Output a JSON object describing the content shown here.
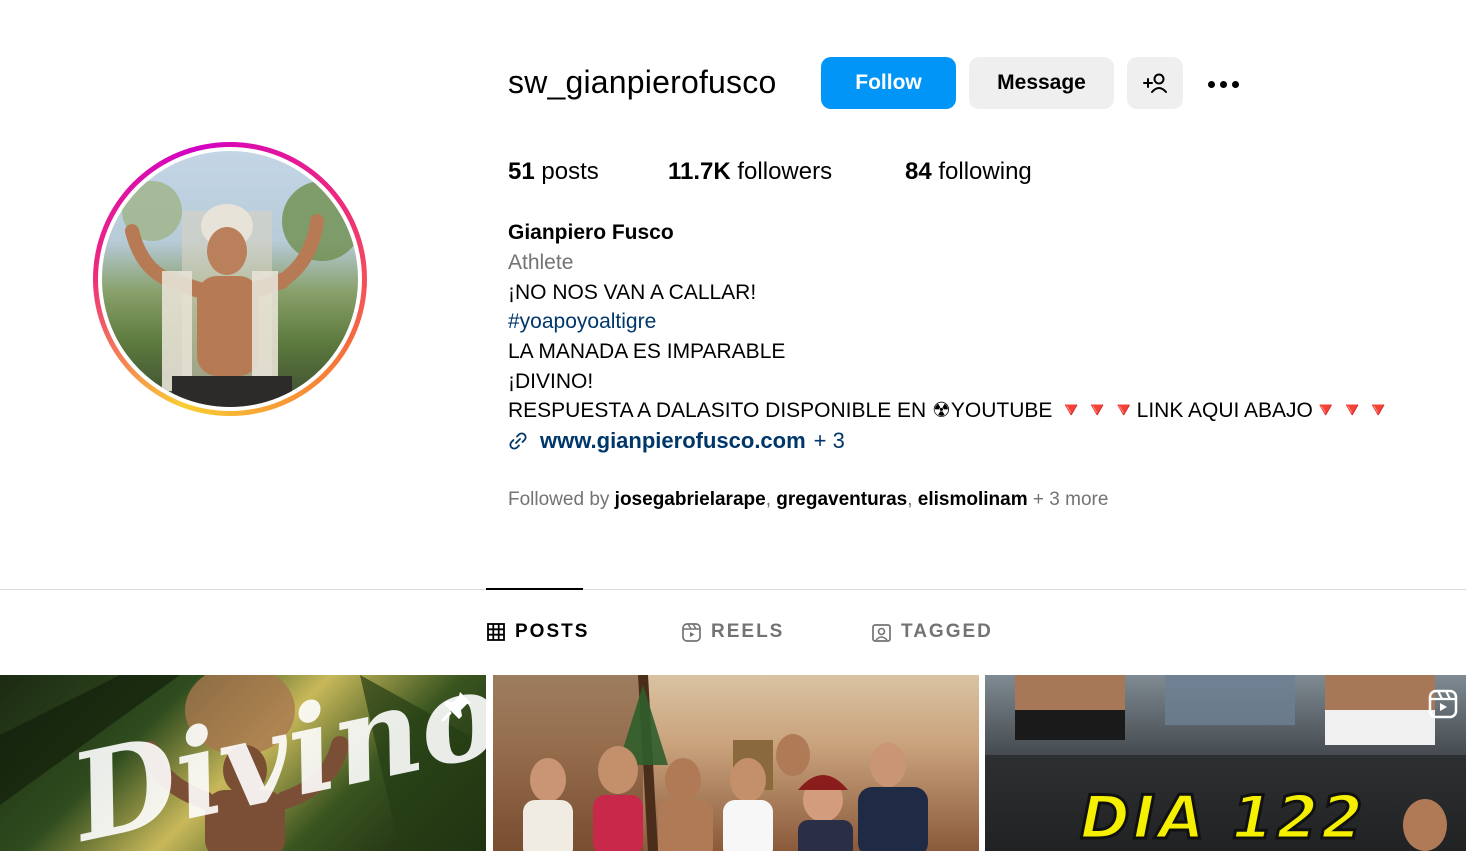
{
  "profile": {
    "username": "sw_gianpierofusco",
    "follow_label": "Follow",
    "message_label": "Message",
    "stats": {
      "posts_count": "51",
      "posts_label": "posts",
      "followers_count": "11.7K",
      "followers_label": "followers",
      "following_count": "84",
      "following_label": "following"
    },
    "full_name": "Gianpiero Fusco",
    "category": "Athlete",
    "bio_lines": {
      "line1": "¡NO NOS VAN A CALLAR!",
      "hashtag": "#yoapoyoaltigre",
      "line3": "LA MANADA ES IMPARABLE",
      "line4": "¡DIVINO!",
      "line5": "RESPUESTA A DALASITO DISPONIBLE EN ☢YOUTUBE 🔻🔻🔻LINK AQUI ABAJO🔻🔻🔻"
    },
    "link": "www.gianpierofusco.com",
    "link_more": "+ 3",
    "followed_by": {
      "prefix": "Followed by",
      "users": [
        "josegabrielarape",
        "gregaventuras",
        "elismolinam"
      ],
      "more": "+ 3 more"
    }
  },
  "tabs": [
    {
      "label": "POSTS",
      "icon": "grid-icon",
      "active": true
    },
    {
      "label": "REELS",
      "icon": "reels-icon",
      "active": false
    },
    {
      "label": "TAGGED",
      "icon": "tagged-icon",
      "active": false
    }
  ],
  "posts": [
    {
      "type": "pinned",
      "overlay_text": "Divino"
    },
    {
      "type": "photo"
    },
    {
      "type": "reel",
      "overlay_text": "DIA 122"
    }
  ],
  "colors": {
    "accent": "#0095f6",
    "link": "#00376b",
    "muted": "#737373",
    "button_bg": "#efefef"
  }
}
